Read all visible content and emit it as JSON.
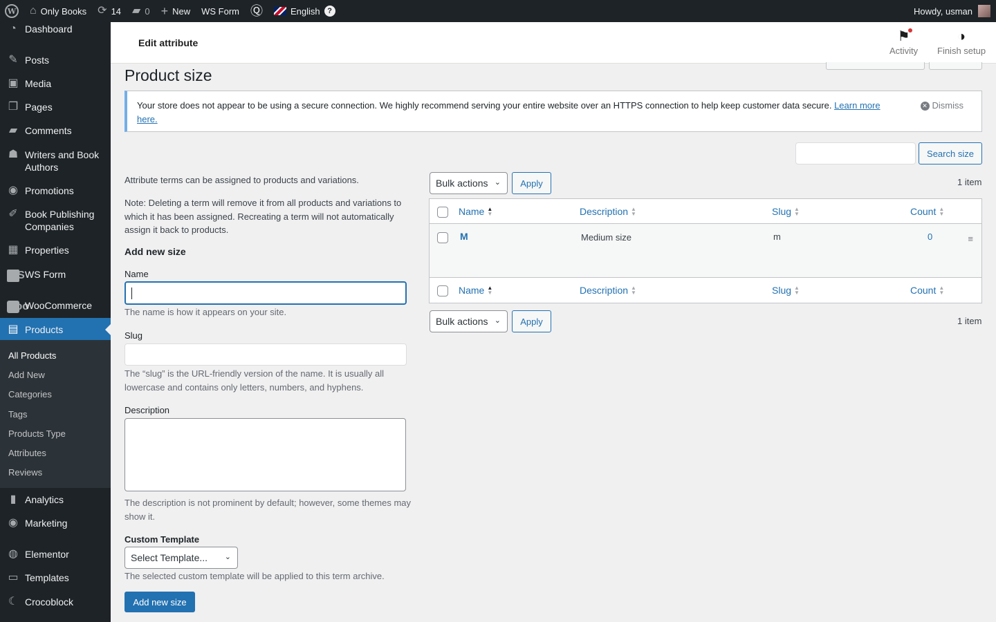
{
  "admin_bar": {
    "site_name": "Only Books",
    "updates_count": "14",
    "comments_count": "0",
    "new_label": "New",
    "ws_form_label": "WS Form",
    "language_label": "English",
    "howdy_label": "Howdy, usman"
  },
  "sidebar": {
    "items": [
      {
        "label": "Dashboard",
        "icon": "dashboard-icon"
      },
      {
        "label": "Posts",
        "icon": "pin-icon"
      },
      {
        "label": "Media",
        "icon": "media-icon"
      },
      {
        "label": "Pages",
        "icon": "pages-icon"
      },
      {
        "label": "Comments",
        "icon": "comments-icon"
      },
      {
        "label": "Writers and Book Authors",
        "icon": "users-icon"
      },
      {
        "label": "Promotions",
        "icon": "megaphone-icon"
      },
      {
        "label": "Book Publishing Companies",
        "icon": "edit-icon"
      },
      {
        "label": "Properties",
        "icon": "building-icon"
      },
      {
        "label": "WS Form",
        "icon": "ws-form-icon",
        "glyph": "WS"
      },
      {
        "label": "WooCommerce",
        "icon": "woocommerce-icon",
        "glyph": "woo"
      },
      {
        "label": "Products",
        "icon": "archive-icon"
      },
      {
        "label": "Analytics",
        "icon": "bar-chart-icon"
      },
      {
        "label": "Marketing",
        "icon": "megaphone-icon"
      },
      {
        "label": "Elementor",
        "icon": "elementor-icon"
      },
      {
        "label": "Templates",
        "icon": "folder-icon"
      },
      {
        "label": "Crocoblock",
        "icon": "crocoblock-icon"
      }
    ],
    "submenu": [
      "All Products",
      "Add New",
      "Categories",
      "Tags",
      "Products Type",
      "Attributes",
      "Reviews"
    ]
  },
  "header": {
    "title": "Edit attribute",
    "activity_label": "Activity",
    "finish_setup_label": "Finish setup"
  },
  "page": {
    "title": "Product size",
    "notice_text": "Your store does not appear to be using a secure connection. We highly recommend serving your entire website over an HTTPS connection to help keep customer data secure.",
    "notice_link": "Learn more here.",
    "dismiss_label": "Dismiss",
    "search_button": "Search size",
    "intro_text": "Attribute terms can be assigned to products and variations.",
    "note_text": "Note: Deleting a term will remove it from all products and variations to which it has been assigned. Recreating a term will not automatically assign it back to products.",
    "add_new_heading": "Add new size",
    "name_label": "Name",
    "name_help": "The name is how it appears on your site.",
    "slug_label": "Slug",
    "slug_help": "The “slug” is the URL-friendly version of the name. It is usually all lowercase and contains only letters, numbers, and hyphens.",
    "description_label": "Description",
    "description_help": "The description is not prominent by default; however, some themes may show it.",
    "custom_template_label": "Custom Template",
    "template_select_value": "Select Template...",
    "template_help": "The selected custom template will be applied to this term archive.",
    "submit_label": "Add new size"
  },
  "table": {
    "bulk_actions_label": "Bulk actions",
    "apply_label": "Apply",
    "items_count": "1 item",
    "columns": [
      "Name",
      "Description",
      "Slug",
      "Count"
    ],
    "rows": [
      {
        "name": "M",
        "description": "Medium size",
        "slug": "m",
        "count": "0"
      }
    ]
  },
  "colors": {
    "accent": "#2271b1",
    "admin_dark": "#1d2327",
    "notice_info": "#72aee6"
  }
}
